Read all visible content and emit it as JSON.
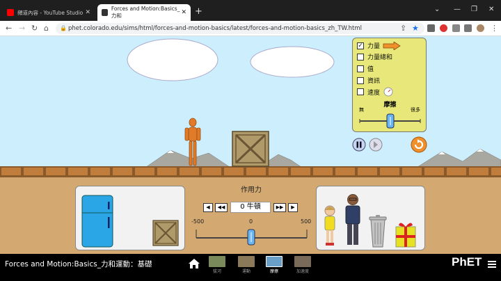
{
  "browser": {
    "tabs": [
      {
        "title": "頻道內容 - YouTube Studio",
        "active": false
      },
      {
        "title": "Forces and Motion:Basics_力和",
        "active": true
      }
    ],
    "url": "phet.colorado.edu/sims/html/forces-and-motion-basics/latest/forces-and-motion-basics_zh_TW.html",
    "new_tab": "+",
    "window_controls": [
      "⌄",
      "—",
      "❐",
      "✕"
    ]
  },
  "controls": {
    "items": [
      {
        "label": "力量",
        "checked": true
      },
      {
        "label": "力量總和",
        "checked": false
      },
      {
        "label": "值",
        "checked": false
      },
      {
        "label": "資訊",
        "checked": false
      },
      {
        "label": "速度",
        "checked": false
      }
    ],
    "friction_label": "摩擦",
    "friction_min": "無",
    "friction_max": "很多"
  },
  "applied_force": {
    "title": "作用力",
    "value": "0 牛頓",
    "min": "-500",
    "mid": "0",
    "max": "500"
  },
  "bottom": {
    "sim_title": "Forces and Motion:Basics_力和運動：基礎",
    "screens": [
      "拔河",
      "運動",
      "摩擦",
      "加速度"
    ],
    "logo": "PhET"
  },
  "colors": {
    "sky": "#cdeefc",
    "ground": "#d4a971",
    "control_panel": "#e7e879",
    "accent_orange": "#f0902a"
  }
}
